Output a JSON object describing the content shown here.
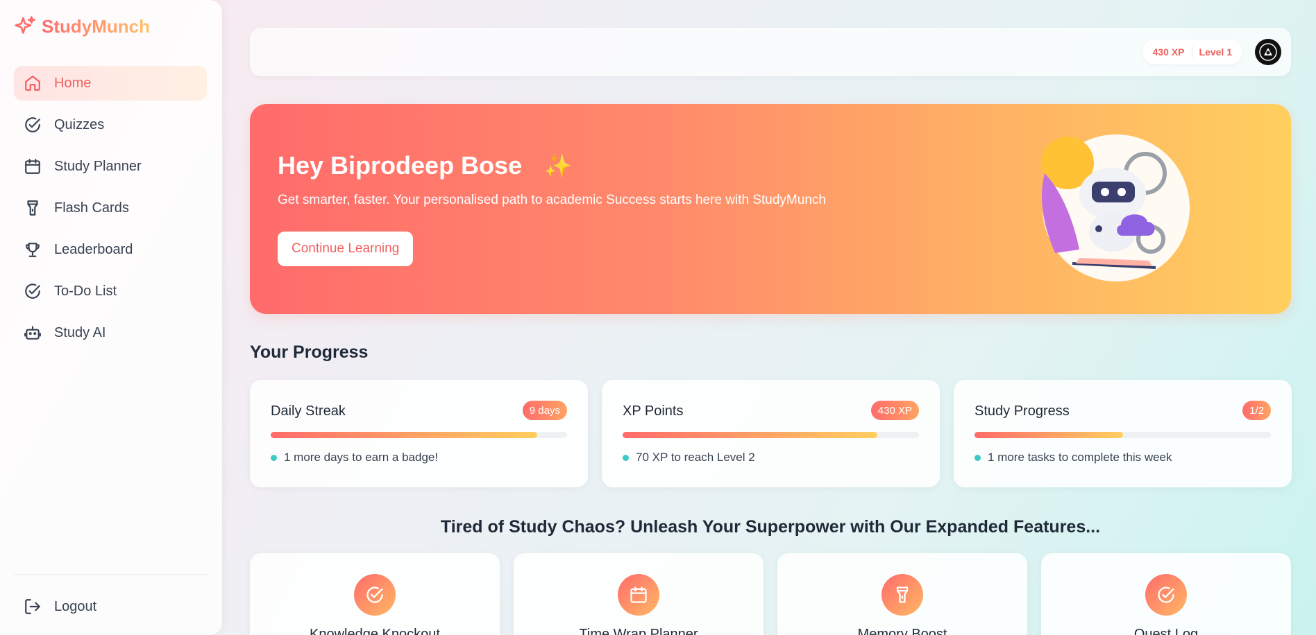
{
  "brand": {
    "name": "StudyMunch"
  },
  "sidebar": {
    "items": [
      {
        "label": "Home",
        "icon": "home-icon",
        "active": true
      },
      {
        "label": "Quizzes",
        "icon": "check-circle-icon"
      },
      {
        "label": "Study Planner",
        "icon": "calendar-icon"
      },
      {
        "label": "Flash Cards",
        "icon": "flashlight-icon"
      },
      {
        "label": "Leaderboard",
        "icon": "trophy-icon"
      },
      {
        "label": "To-Do List",
        "icon": "check-circle-icon"
      },
      {
        "label": "Study AI",
        "icon": "robot-icon"
      }
    ],
    "logout_label": "Logout"
  },
  "topbar": {
    "xp": "430 XP",
    "level": "Level 1"
  },
  "hero": {
    "title": "Hey Biprodeep Bose",
    "sparkle": "✨",
    "subtitle": "Get smarter, faster. Your personalised path to academic Success starts here with StudyMunch",
    "button": "Continue Learning"
  },
  "progress": {
    "title": "Your Progress",
    "cards": [
      {
        "title": "Daily Streak",
        "badge": "9 days",
        "fill": 0.9,
        "note": "1 more days to earn a badge!"
      },
      {
        "title": "XP Points",
        "badge": "430 XP",
        "fill": 0.86,
        "note": "70 XP to reach Level 2"
      },
      {
        "title": "Study Progress",
        "badge": "1/2",
        "fill": 0.5,
        "note": "1 more tasks to complete this week"
      }
    ]
  },
  "features": {
    "title": "Tired of Study Chaos? Unleash Your Superpower with Our Expanded Features...",
    "items": [
      {
        "label": "Knowledge Knockout",
        "icon": "check-circle-icon"
      },
      {
        "label": "Time Wrap Planner",
        "icon": "calendar-icon"
      },
      {
        "label": "Memory Boost",
        "icon": "flashlight-icon"
      },
      {
        "label": "Quest Log",
        "icon": "check-circle-icon"
      }
    ]
  },
  "colors": {
    "accent": "#f0605f",
    "gradient_start": "#ff6b6b",
    "gradient_end": "#ffcf5f",
    "dot": "#3cc8c4"
  }
}
